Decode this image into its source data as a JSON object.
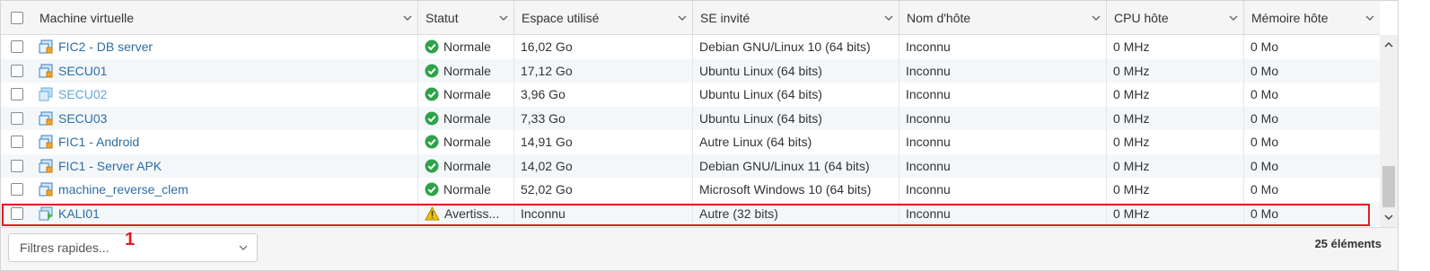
{
  "columns": [
    {
      "label": "Machine virtuelle"
    },
    {
      "label": "Statut"
    },
    {
      "label": "Espace utilisé"
    },
    {
      "label": "SE invité"
    },
    {
      "label": "Nom d'hôte"
    },
    {
      "label": "CPU hôte"
    },
    {
      "label": "Mémoire hôte"
    }
  ],
  "rows": [
    {
      "name": "FIC2 - DB server",
      "status": "Normale",
      "status_kind": "ok",
      "space": "16,02 Go",
      "os": "Debian GNU/Linux 10 (64 bits)",
      "host": "Inconnu",
      "cpu": "0 MHz",
      "mem": "0 Mo",
      "icon": "vm-icon"
    },
    {
      "name": "SECU01",
      "status": "Normale",
      "status_kind": "ok",
      "space": "17,12 Go",
      "os": "Ubuntu Linux (64 bits)",
      "host": "Inconnu",
      "cpu": "0 MHz",
      "mem": "0 Mo",
      "icon": "vm-icon"
    },
    {
      "name": "SECU02",
      "status": "Normale",
      "status_kind": "ok",
      "space": "3,96 Go",
      "os": "Ubuntu Linux (64 bits)",
      "host": "Inconnu",
      "cpu": "0 MHz",
      "mem": "0 Mo",
      "icon": "vm-template-icon"
    },
    {
      "name": "SECU03",
      "status": "Normale",
      "status_kind": "ok",
      "space": "7,33 Go",
      "os": "Ubuntu Linux (64 bits)",
      "host": "Inconnu",
      "cpu": "0 MHz",
      "mem": "0 Mo",
      "icon": "vm-icon"
    },
    {
      "name": "FIC1 - Android",
      "status": "Normale",
      "status_kind": "ok",
      "space": "14,91 Go",
      "os": "Autre Linux (64 bits)",
      "host": "Inconnu",
      "cpu": "0 MHz",
      "mem": "0 Mo",
      "icon": "vm-icon"
    },
    {
      "name": "FIC1 - Server APK",
      "status": "Normale",
      "status_kind": "ok",
      "space": "14,02 Go",
      "os": "Debian GNU/Linux 11 (64 bits)",
      "host": "Inconnu",
      "cpu": "0 MHz",
      "mem": "0 Mo",
      "icon": "vm-icon"
    },
    {
      "name": "machine_reverse_clem",
      "status": "Normale",
      "status_kind": "ok",
      "space": "52,02 Go",
      "os": "Microsoft Windows 10 (64 bits)",
      "host": "Inconnu",
      "cpu": "0 MHz",
      "mem": "0 Mo",
      "icon": "vm-icon"
    },
    {
      "name": "KALI01",
      "status": "Avertiss...",
      "status_kind": "warning",
      "space": "Inconnu",
      "os": "Autre (32 bits)",
      "host": "Inconnu",
      "cpu": "0 MHz",
      "mem": "0 Mo",
      "icon": "vm-warning-icon"
    }
  ],
  "footer": {
    "quick_filter_label": "Filtres rapides...",
    "annotation_marker": "1",
    "item_count": "25 éléments"
  },
  "colors": {
    "link": "#2e6da4",
    "ok": "#2ea34a",
    "warning": "#f2c200",
    "highlight": "#e11b22"
  }
}
